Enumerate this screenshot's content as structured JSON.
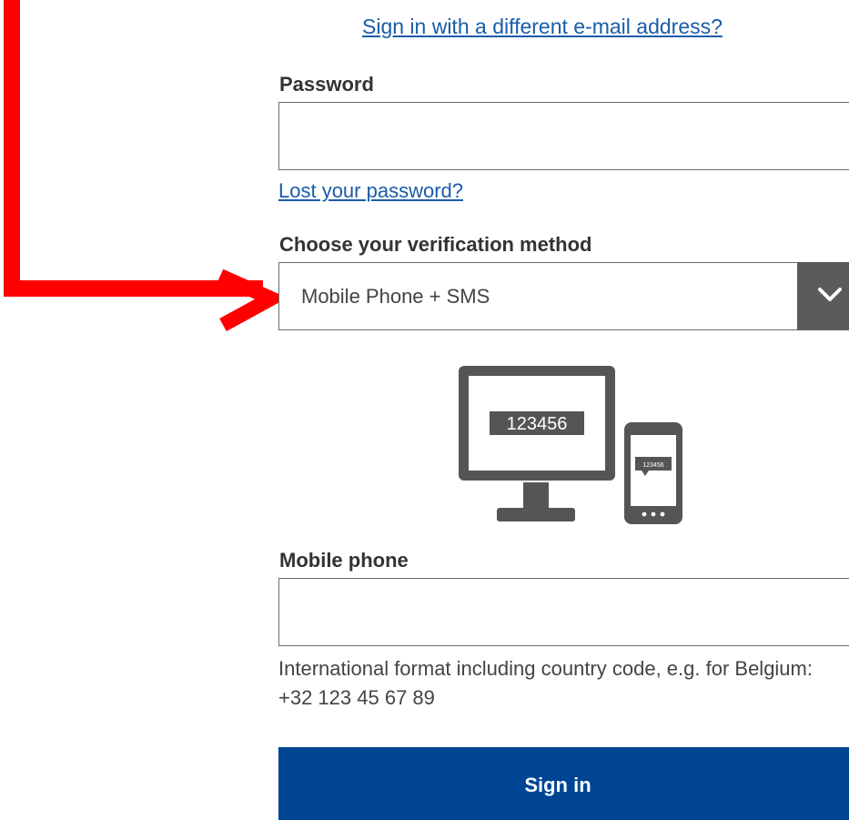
{
  "links": {
    "different_email": "Sign in with a different e-mail address?",
    "lost_password": "Lost your password?"
  },
  "password": {
    "label": "Password",
    "value": ""
  },
  "verification": {
    "label": "Choose your verification method",
    "selected": "Mobile Phone + SMS"
  },
  "illustration": {
    "monitor_code": "123456",
    "phone_code": "123456"
  },
  "mobile": {
    "label": "Mobile phone",
    "value": "",
    "hint": "International format including country code, e.g. for Belgium: +32 123 45 67 89"
  },
  "signin_label": "Sign in",
  "colors": {
    "link": "#1a5ca8",
    "primary_button": "#004494",
    "annotation_arrow": "#ff0000",
    "illustration": "#555555"
  }
}
